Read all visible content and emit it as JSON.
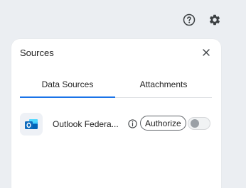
{
  "toolbar": {
    "help_icon": "help-circle-icon",
    "settings_icon": "gear-icon"
  },
  "panel": {
    "title": "Sources",
    "close_icon": "close-icon",
    "tabs": [
      {
        "label": "Data Sources",
        "selected": true
      },
      {
        "label": "Attachments",
        "selected": false
      }
    ],
    "sources": [
      {
        "name": "Outlook Federa...",
        "icon": "outlook-icon",
        "info_icon": "info-icon",
        "authorize_label": "Authorize",
        "enabled": false
      }
    ]
  },
  "colors": {
    "background": "#ebeef2",
    "accent": "#1a73e8",
    "outlook_blue": "#0f6cbd"
  }
}
